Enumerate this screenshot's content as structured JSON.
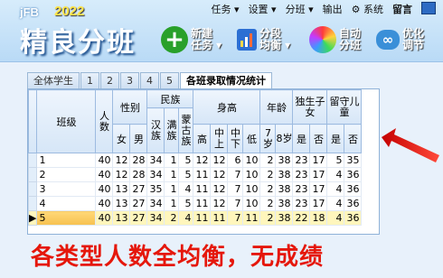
{
  "app": {
    "brand": "jFB",
    "year": "2022",
    "title": "精良分班"
  },
  "menu": {
    "items": [
      "任务 ▾",
      "设置 ▾",
      "分班 ▾",
      "输出",
      "系统",
      "留言"
    ]
  },
  "toolbar": [
    {
      "l1": "新建",
      "l2": "任务 ▾",
      "color": "#29a02a",
      "icon": "plus-icon"
    },
    {
      "l1": "分段",
      "l2": "均衡 ▾",
      "color": "#2c6fd3",
      "icon": "bar-chart-icon"
    },
    {
      "l1": "自动",
      "l2": "分班",
      "color": "#e04a9e",
      "icon": "color-wheel-icon"
    },
    {
      "l1": "优化",
      "l2": "调节",
      "color": "#3a8fd8",
      "icon": "infinity-icon"
    }
  ],
  "tabs": [
    "全体学生",
    "1",
    "2",
    "3",
    "4",
    "5",
    "各班录取情况统计"
  ],
  "table": {
    "headers": {
      "class": "班级",
      "count": "人数",
      "gender": "性别",
      "female": "女",
      "male": "男",
      "ethnic": "民族",
      "han": "汉族",
      "man": "满族",
      "mongol": "蒙古族",
      "height": "身高",
      "high": "高",
      "midhigh": "中上",
      "mid": "中下",
      "low": "低",
      "age": "年龄",
      "age7": "7岁",
      "age8": "8岁",
      "only": "独生子女",
      "yes": "是",
      "no": "否",
      "left": "留守儿童",
      "yes2": "是",
      "no2": "否"
    },
    "rows": [
      [
        "1",
        "40",
        "12",
        "28",
        "34",
        "1",
        "5",
        "12",
        "12",
        "6",
        "10",
        "2",
        "38",
        "23",
        "17",
        "5",
        "35"
      ],
      [
        "2",
        "40",
        "12",
        "28",
        "34",
        "1",
        "5",
        "11",
        "12",
        "7",
        "10",
        "2",
        "38",
        "23",
        "17",
        "4",
        "36"
      ],
      [
        "3",
        "40",
        "13",
        "27",
        "35",
        "1",
        "4",
        "11",
        "12",
        "7",
        "10",
        "2",
        "38",
        "23",
        "17",
        "4",
        "36"
      ],
      [
        "4",
        "40",
        "13",
        "27",
        "34",
        "1",
        "5",
        "11",
        "12",
        "7",
        "10",
        "2",
        "38",
        "23",
        "17",
        "4",
        "36"
      ],
      [
        "5",
        "40",
        "13",
        "27",
        "34",
        "2",
        "4",
        "11",
        "11",
        "7",
        "11",
        "2",
        "38",
        "22",
        "18",
        "4",
        "36"
      ]
    ]
  },
  "caption": "各类型人数全均衡，无成绩",
  "colors": {
    "caption": "#e5170b",
    "header_bg": "#d6e6f7",
    "selected_row": "#fff6bc"
  }
}
